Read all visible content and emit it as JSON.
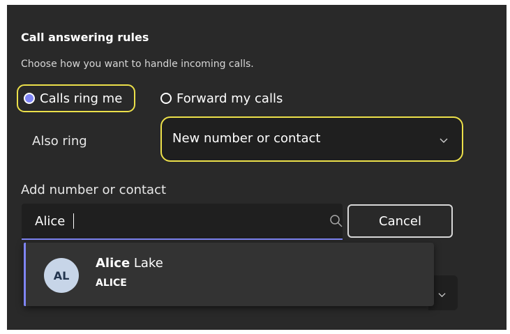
{
  "section": {
    "title": "Call answering rules",
    "subtitle": "Choose how you want to handle incoming calls."
  },
  "radio_options": [
    {
      "label": "Calls ring me",
      "selected": true
    },
    {
      "label": "Forward my calls",
      "selected": false
    }
  ],
  "also_ring": {
    "label": "Also ring",
    "value": "New number or contact",
    "icon": "chevron-down-icon"
  },
  "add_contact": {
    "label": "Add number or contact",
    "search_value": "Alice",
    "search_icon": "search-icon",
    "cancel_label": "Cancel"
  },
  "suggestions": [
    {
      "initials": "AL",
      "name_match": "Alice",
      "name_rest": " Lake",
      "alias": "ALICE"
    }
  ],
  "colors": {
    "panel_background": "#292929",
    "accent": "#7f85f5",
    "highlight": "#ece04a",
    "avatar_background": "#c7d5e8"
  }
}
